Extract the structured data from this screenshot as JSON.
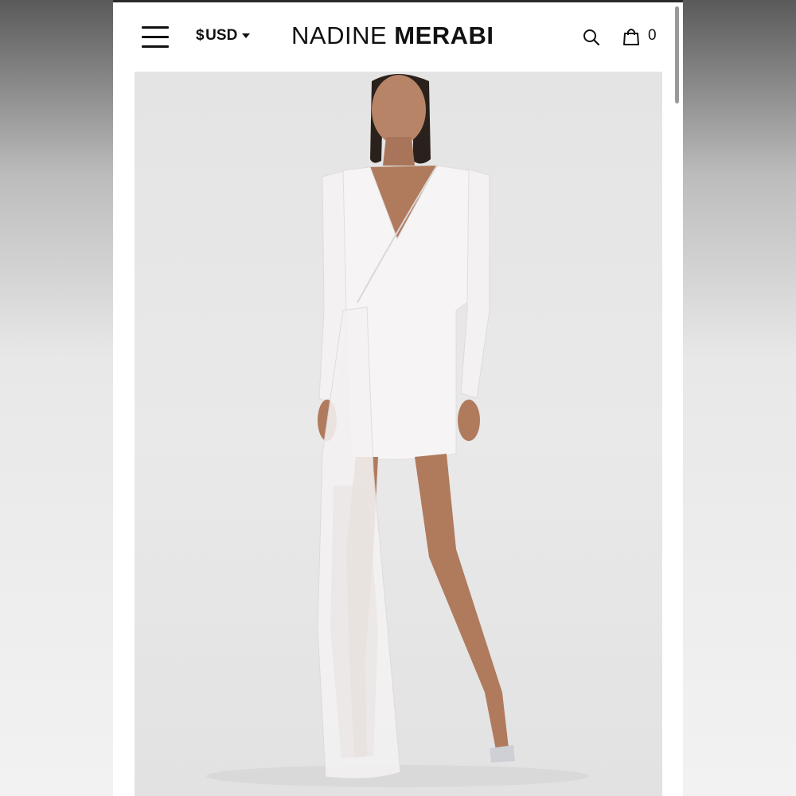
{
  "header": {
    "currency_symbol": "$",
    "currency_code": "USD",
    "brand_first": "NADINE",
    "brand_second": "MERABI",
    "cart_count": "0"
  },
  "product": {
    "image_icon": "white-sequin-dress-photo"
  },
  "colors": {
    "background": "#ffffff",
    "text": "#111111",
    "photo_backdrop": "#e6e6e6"
  }
}
